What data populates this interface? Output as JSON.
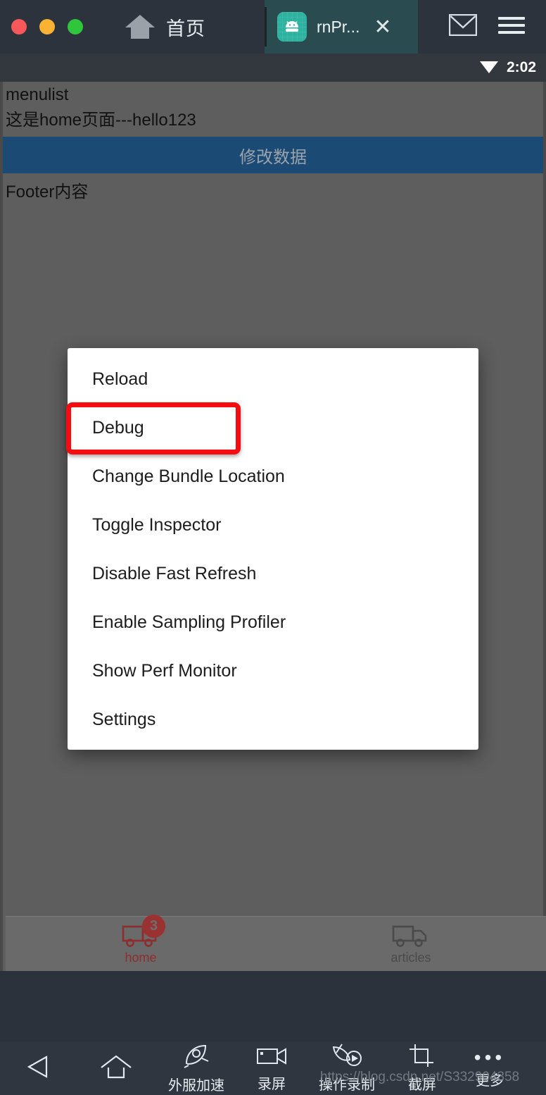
{
  "titlebar": {
    "window_controls": [
      "close",
      "minimize",
      "maximize"
    ],
    "home_label": "首页",
    "home_icon": "home-icon",
    "active_tab": {
      "icon": "android-app-icon",
      "title": "rnPr...",
      "close": "✕"
    },
    "mail_icon": "mail-icon",
    "menu_icon": "hamburger-menu-icon"
  },
  "statusbar": {
    "wifi_icon": "wifi-icon",
    "time": "2:02"
  },
  "app": {
    "list_label": "menulist",
    "body_text": "这是home页面---hello123",
    "action_button": "修改数据",
    "footer_text": "Footer内容"
  },
  "dev_menu": {
    "items": [
      {
        "label": "Reload",
        "highlighted": false
      },
      {
        "label": "Debug",
        "highlighted": true
      },
      {
        "label": "Change Bundle Location",
        "highlighted": false
      },
      {
        "label": "Toggle Inspector",
        "highlighted": false
      },
      {
        "label": "Disable Fast Refresh",
        "highlighted": false
      },
      {
        "label": "Enable Sampling Profiler",
        "highlighted": false
      },
      {
        "label": "Show Perf Monitor",
        "highlighted": false
      },
      {
        "label": "Settings",
        "highlighted": false
      }
    ],
    "highlight_color": "#f40c11"
  },
  "tabbar": {
    "tabs": [
      {
        "label": "home",
        "icon": "truck-icon",
        "badge": "3",
        "active": true
      },
      {
        "label": "articles",
        "icon": "truck-icon",
        "badge": "",
        "active": false
      }
    ],
    "active_color": "#8e2d2d",
    "inactive_color": "#4a4a4a"
  },
  "bottombar": {
    "back_icon": "back-triangle-icon",
    "home_icon": "home-outline-icon",
    "items": [
      {
        "label": "外服加速",
        "icon": "rocket-icon"
      },
      {
        "label": "录屏",
        "icon": "video-camera-icon"
      },
      {
        "label": "操作录制",
        "icon": "macro-record-icon"
      },
      {
        "label": "截屏",
        "icon": "crop-screenshot-icon"
      },
      {
        "label": "更多",
        "icon": "more-dots-icon"
      }
    ],
    "watermark": "https://blog.csdn.net/S332904358"
  }
}
